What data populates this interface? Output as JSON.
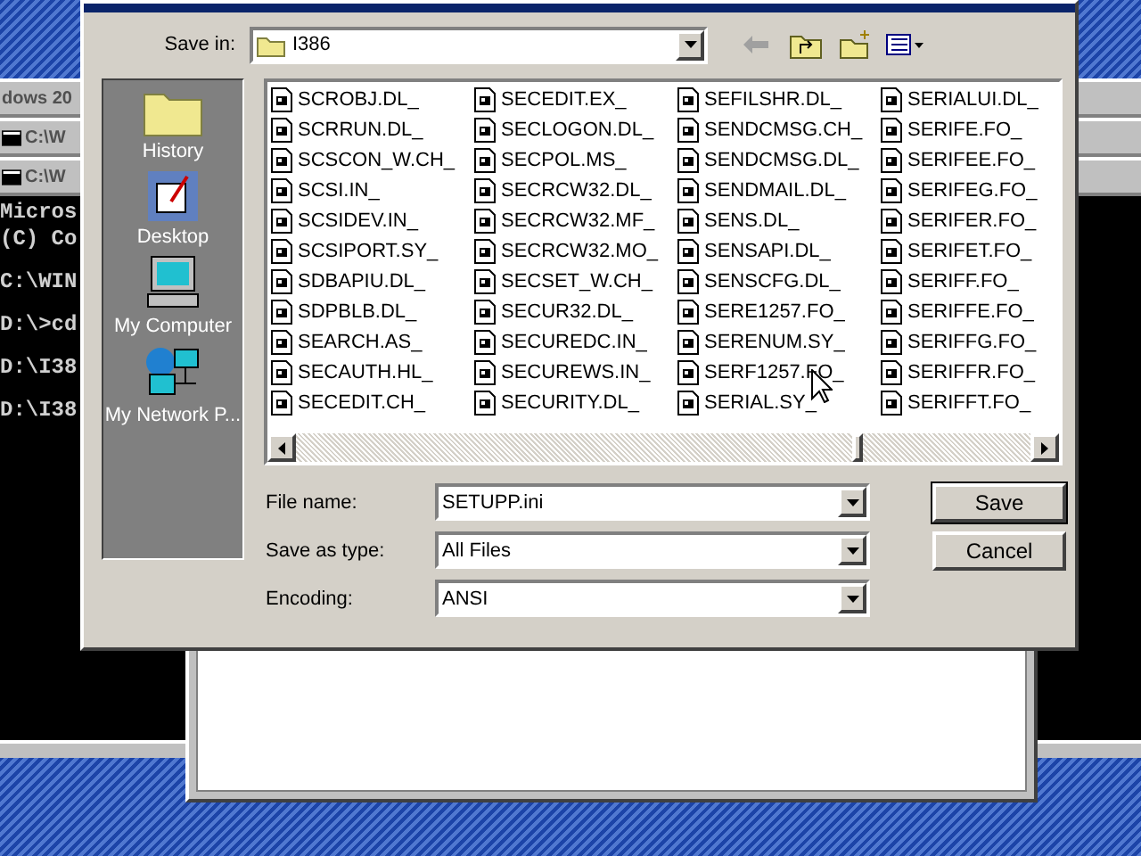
{
  "desktop": {
    "background_windows": [
      {
        "title": "dows 20",
        "kind": "plain"
      },
      {
        "title": "C:\\W",
        "kind": "console"
      },
      {
        "title": "C:\\W",
        "kind": "console"
      }
    ],
    "console_lines": [
      "Micros",
      "(C) Co",
      "C:\\WIN",
      "D:\\>cd",
      "D:\\I38",
      "D:\\I38"
    ]
  },
  "dialog": {
    "save_in": {
      "label": "Save in:",
      "value": "I386"
    },
    "places": [
      {
        "label": "History",
        "kind": "history"
      },
      {
        "label": "Desktop",
        "kind": "desktop"
      },
      {
        "label": "My Computer",
        "kind": "computer"
      },
      {
        "label": "My Network P...",
        "kind": "network"
      }
    ],
    "files": [
      "SCROBJ.DL_",
      "SCRRUN.DL_",
      "SCSCON_W.CH_",
      "SCSI.IN_",
      "SCSIDEV.IN_",
      "SCSIPORT.SY_",
      "SDBAPIU.DL_",
      "SDPBLB.DL_",
      "SEARCH.AS_",
      "SECAUTH.HL_",
      "SECEDIT.CH_",
      "SECEDIT.EX_",
      "SECLOGON.DL_",
      "SECPOL.MS_",
      "SECRCW32.DL_",
      "SECRCW32.MF_",
      "SECRCW32.MO_",
      "SECSET_W.CH_",
      "SECUR32.DL_",
      "SECUREDC.IN_",
      "SECUREWS.IN_",
      "SECURITY.DL_",
      "SEFILSHR.DL_",
      "SENDCMSG.CH_",
      "SENDCMSG.DL_",
      "SENDMAIL.DL_",
      "SENS.DL_",
      "SENSAPI.DL_",
      "SENSCFG.DL_",
      "SERE1257.FO_",
      "SERENUM.SY_",
      "SERF1257.FO_",
      "SERIAL.SY_",
      "SERIALUI.DL_",
      "SERIFE.FO_",
      "SERIFEE.FO_",
      "SERIFEG.FO_",
      "SERIFER.FO_",
      "SERIFET.FO_",
      "SERIFF.FO_",
      "SERIFFE.FO_",
      "SERIFFG.FO_",
      "SERIFFR.FO_",
      "SERIFFT.FO_"
    ],
    "fields": [
      {
        "label": "File name:",
        "value": "SETUPP.ini"
      },
      {
        "label": "Save as type:",
        "value": "All Files"
      },
      {
        "label": "Encoding:",
        "value": "ANSI"
      }
    ],
    "buttons": [
      {
        "label": "Save",
        "default": true
      },
      {
        "label": "Cancel",
        "default": false
      }
    ]
  }
}
